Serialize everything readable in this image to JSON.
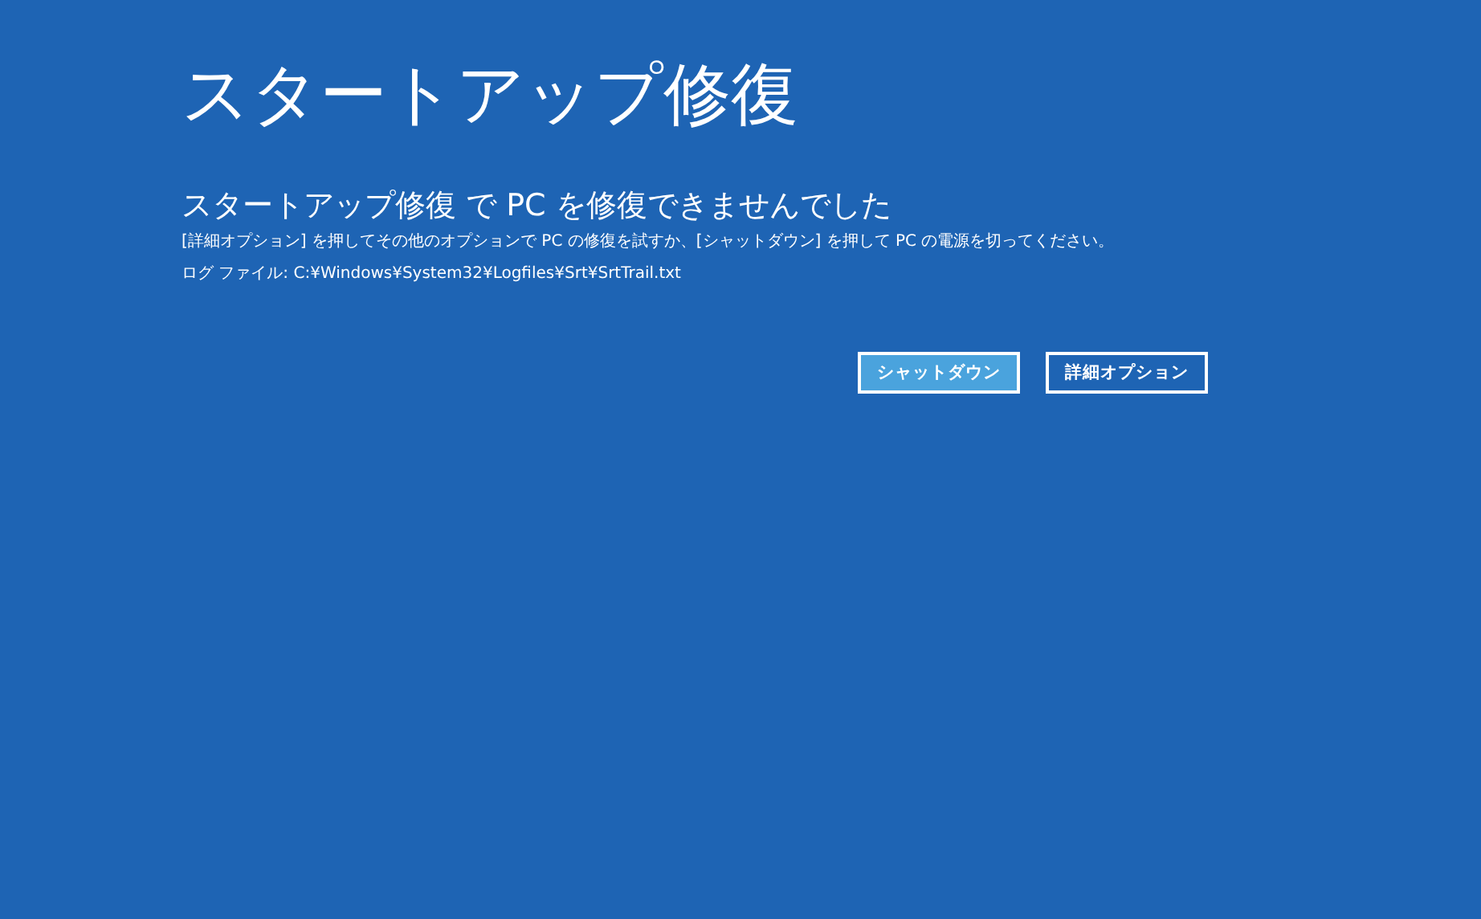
{
  "title": "スタートアップ修復",
  "heading": "スタートアップ修復 で PC を修復できませんでした",
  "message": "[詳細オプション] を押してその他のオプションで PC の修復を試すか、[シャットダウン] を押して PC の電源を切ってください。",
  "log": "ログ ファイル: C:¥Windows¥System32¥Logfiles¥Srt¥SrtTrail.txt",
  "buttons": [
    {
      "label": "シャットダウン",
      "selected": true
    },
    {
      "label": "詳細オプション",
      "selected": false
    }
  ]
}
